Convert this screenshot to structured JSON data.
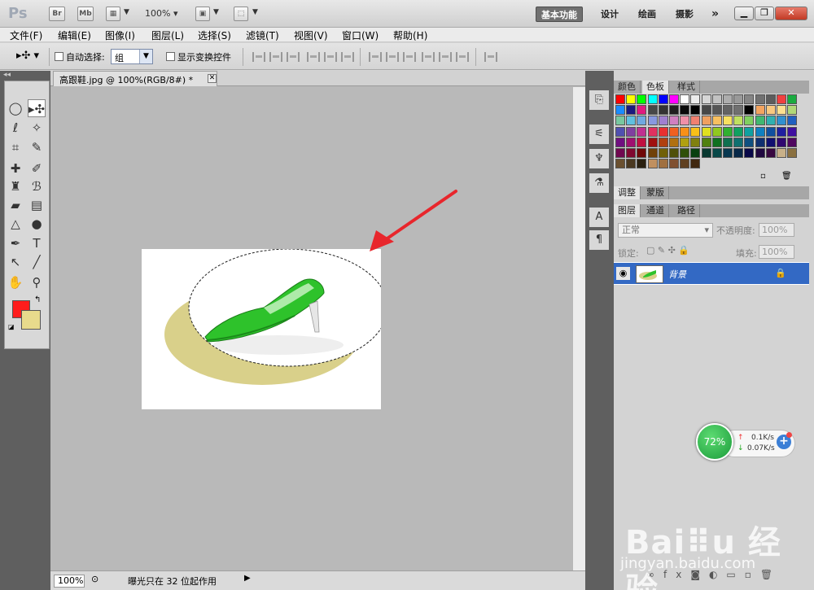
{
  "app": {
    "logo": "Ps",
    "bridge_label": "Br",
    "minibridge_label": "Mb",
    "zoom": "100%",
    "workspaces": [
      "基本功能",
      "设计",
      "绘画",
      "摄影"
    ],
    "more_label": "»"
  },
  "menu": [
    "文件(F)",
    "编辑(E)",
    "图像(I)",
    "图层(L)",
    "选择(S)",
    "滤镜(T)",
    "视图(V)",
    "窗口(W)",
    "帮助(H)"
  ],
  "options": {
    "auto_select_label": "自动选择:",
    "auto_select_value": "组",
    "show_transform_label": "显示变换控件"
  },
  "document": {
    "tab_title": "高跟鞋.jpg @ 100%(RGB/8#) *",
    "zoom": "100%",
    "status": "曝光只在 32 位起作用"
  },
  "panels": {
    "top_tabs": [
      "颜色",
      "色板",
      "样式"
    ],
    "adjust_tabs": [
      "调整",
      "蒙版"
    ],
    "layer_tabs": [
      "图层",
      "通道",
      "路径"
    ],
    "blend_mode": "正常",
    "opacity_label": "不透明度:",
    "opacity_value": "100%",
    "lock_label": "锁定:",
    "fill_label": "填充:",
    "fill_value": "100%",
    "layer_name": "背景"
  },
  "swatch_colors": [
    [
      "#ff0000",
      "#ffff00",
      "#00ff00",
      "#00ffff",
      "#0000ff",
      "#ff00ff",
      "#ffffff",
      "#ebebeb",
      "#d6d6d6",
      "#c2c2c2",
      "#adadad",
      "#999999",
      "#858585",
      "#707070",
      "#5c5c5c",
      "#f04040",
      "#1aab40"
    ],
    [
      "#1a8cff",
      "#1a1a80",
      "#e01a80",
      "#474747",
      "#333333",
      "#1f1f1f",
      "#0a0a0a",
      "#000000",
      "#474747",
      "#555555",
      "#636363",
      "#707070",
      "#000000",
      "#f4a460",
      "#f8c880",
      "#fde090",
      "#b0d878"
    ],
    [
      "#78c8a0",
      "#60c0e0",
      "#70a8e0",
      "#8898e0",
      "#a080d0",
      "#d080c0",
      "#f090a8",
      "#f08070",
      "#f0a060",
      "#f8c060",
      "#f8e060",
      "#c0e060",
      "#80d060",
      "#40b870",
      "#30b0b0",
      "#3090d0",
      "#2060c0"
    ],
    [
      "#5050b0",
      "#8040a0",
      "#c03090",
      "#e03060",
      "#e83030",
      "#f06020",
      "#f89018",
      "#f8c018",
      "#e0e020",
      "#90c820",
      "#30b030",
      "#10a060",
      "#10a0a0",
      "#1080c0",
      "#1050a0",
      "#2020a0",
      "#4010a0"
    ],
    [
      "#701080",
      "#a01070",
      "#c01040",
      "#a01010",
      "#b04010",
      "#b07010",
      "#b0a010",
      "#808010",
      "#508010",
      "#107020",
      "#107050",
      "#107070",
      "#105080",
      "#103070",
      "#101070",
      "#300870",
      "#500860"
    ],
    [
      "#700850",
      "#800830",
      "#700808",
      "#704008",
      "#706008",
      "#505008",
      "#305008",
      "#084010",
      "#083830",
      "#084848",
      "#083850",
      "#082848",
      "#080848",
      "#200840",
      "#380840",
      "#c8b088",
      "#8a7040"
    ],
    [
      "#6a5030",
      "#4a3820",
      "#2a2010",
      "#c09060",
      "#a07040",
      "#805030",
      "#604020",
      "#402810"
    ]
  ]
}
